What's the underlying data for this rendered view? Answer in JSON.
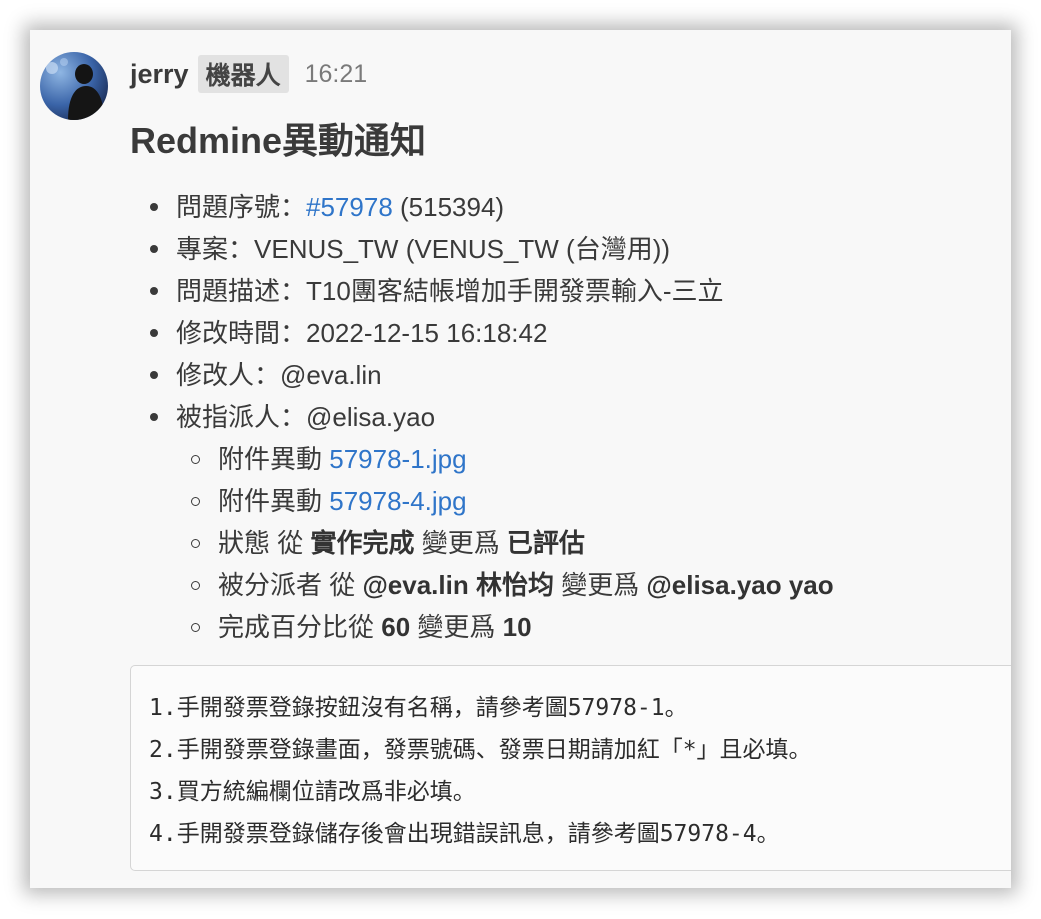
{
  "message": {
    "author": "jerry",
    "bot_badge": "機器人",
    "time": "16:21",
    "title": "Redmine異動通知",
    "details": {
      "issue_label": "問題序號：",
      "issue_link": "#57978",
      "issue_extra": " (515394)",
      "project_label": "專案：",
      "project_value": "VENUS_TW (VENUS_TW (台灣用))",
      "desc_label": "問題描述：",
      "desc_value": "T10團客結帳增加手開發票輸入-三立",
      "modtime_label": "修改時間：",
      "modtime_value": "2022-12-15 16:18:42",
      "modifier_label": "修改人：",
      "modifier_value": "@eva.lin",
      "assignee_label": "被指派人：",
      "assignee_value": "@elisa.yao"
    },
    "changes": {
      "att1_prefix": "附件異動 ",
      "att1_link": "57978-1.jpg",
      "att2_prefix": "附件異動 ",
      "att2_link": "57978-4.jpg",
      "status_prefix": "狀態 從 ",
      "status_from": "實作完成",
      "status_mid": " 變更爲 ",
      "status_to": "已評估",
      "assign_prefix": "被分派者 從 ",
      "assign_from": "@eva.lin 林怡均",
      "assign_mid": " 變更爲 ",
      "assign_to": "@elisa.yao yao",
      "done_prefix": "完成百分比從 ",
      "done_from": "60",
      "done_mid": " 變更爲 ",
      "done_to": "10"
    },
    "notes": [
      "1.手開發票登錄按鈕沒有名稱，請參考圖57978-1。",
      "2.手開發票登錄畫面，發票號碼、發票日期請加紅「*」且必填。",
      "3.買方統編欄位請改爲非必填。",
      "4.手開發票登錄儲存後會出現錯誤訊息，請參考圖57978-4。"
    ]
  },
  "colors": {
    "link": "#2f75c9",
    "text": "#3a3a3a",
    "badge_bg": "#e2e2e2"
  }
}
